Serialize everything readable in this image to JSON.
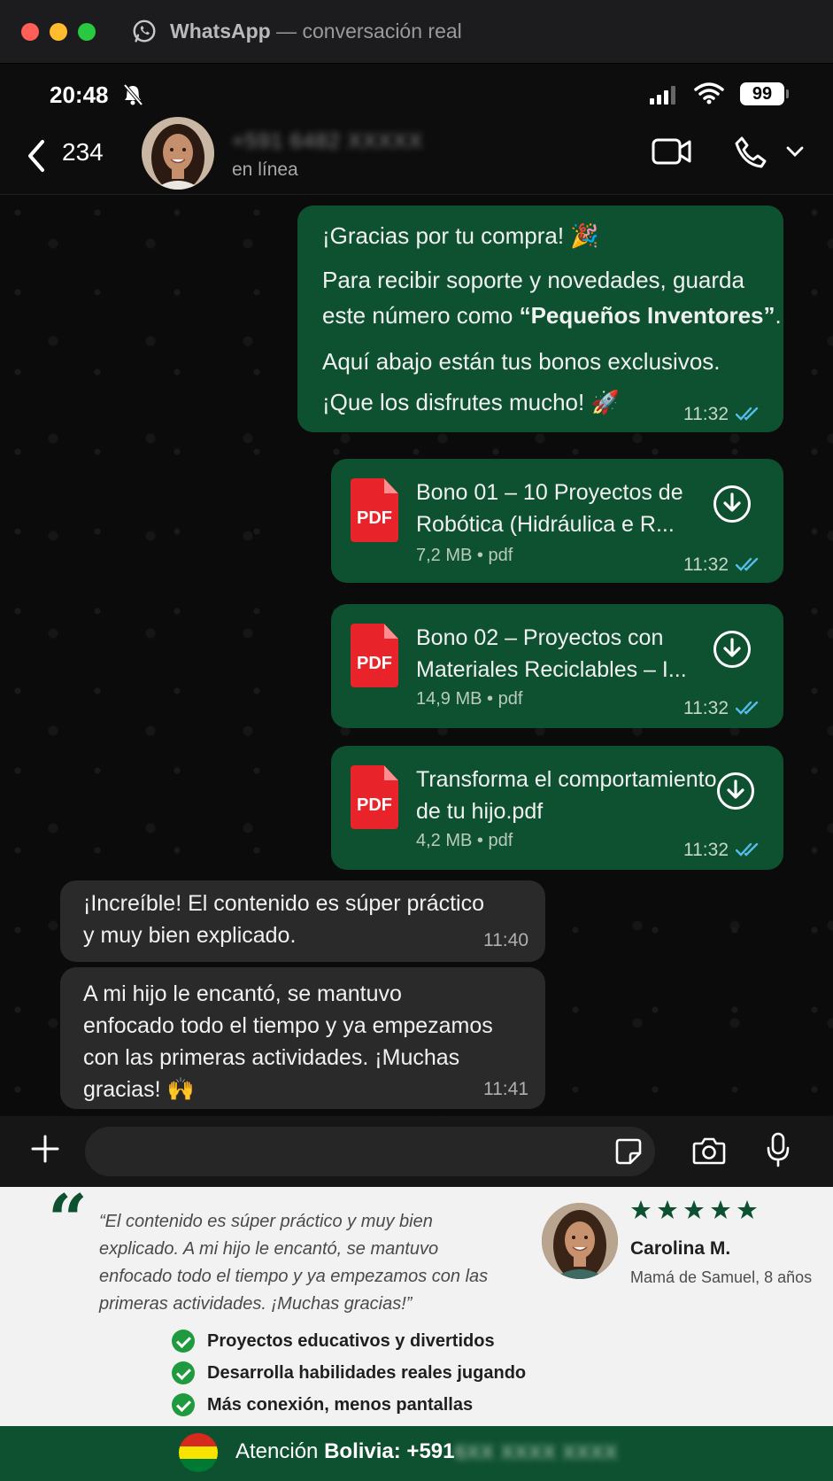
{
  "window": {
    "app_name": "WhatsApp",
    "subtitle": "— conversación real"
  },
  "status_bar": {
    "time": "20:48",
    "battery": "99"
  },
  "chat_header": {
    "unread_count": "234",
    "contact_name": "+591 6482 XXXXX",
    "contact_status": "en línea"
  },
  "messages": {
    "m1": {
      "line1": "¡Gracias por tu compra! 🎉",
      "line2a": "Para recibir soporte y novedades, guarda",
      "line2b_pre": "este número como ",
      "line2b_bold": "“Pequeños Inventores”",
      "line2b_post": ".",
      "line3": "Aquí abajo están tus bonos exclusivos.",
      "line4": "¡Que los disfrutes mucho! 🚀",
      "time": "11:32"
    },
    "doc1": {
      "icon_label": "PDF",
      "title_line1": "Bono 01 – 10 Proyectos de",
      "title_line2": "Robótica (Hidráulica e R...",
      "info": "7,2 MB • pdf",
      "time": "11:32"
    },
    "doc2": {
      "icon_label": "PDF",
      "title_line1": "Bono 02 – Proyectos con",
      "title_line2": "Materiales Reciclables – I...",
      "info": "14,9 MB • pdf",
      "time": "11:32"
    },
    "doc3": {
      "icon_label": "PDF",
      "title_line1": "Transforma el comportamiento",
      "title_line2": "de tu hijo.pdf",
      "info": "4,2 MB • pdf",
      "time": "11:32"
    },
    "in1": {
      "line1": "¡Increíble! El contenido es súper práctico",
      "line2": "y muy bien explicado.",
      "time": "11:40"
    },
    "in2": {
      "line1": "A mi hijo le encantó, se mantuvo",
      "line2": "enfocado todo el tiempo y ya empezamos",
      "line3": "con las primeras actividades. ¡Muchas",
      "line4": "gracias! 🙌",
      "time": "11:41"
    }
  },
  "composer": {
    "placeholder": ""
  },
  "testimonial": {
    "quote_mark": "“",
    "quote": "“El contenido es súper práctico y muy bien explicado. A mi hijo le encantó, se mantuvo enfocado todo el tiempo y ya empezamos con las primeras actividades. ¡Muchas gracias!”",
    "rating": 5,
    "name": "Carolina M.",
    "role": "Mamá de Samuel, 8 años",
    "benefits": [
      "Proyectos educativos y divertidos",
      "Desarrolla habilidades reales jugando",
      "Más conexión, menos pantallas"
    ]
  },
  "footer": {
    "label_pre": "Atención ",
    "label_bold": "Bolivia: +591",
    "blurred_number": "6XX XXXX XXXX"
  },
  "colors": {
    "outgoing_bubble": "#0e5130",
    "incoming_bubble": "#2a2a2a",
    "read_ticks": "#53bdeb",
    "star": "#0e5130",
    "footer_bg": "#0e5130"
  }
}
